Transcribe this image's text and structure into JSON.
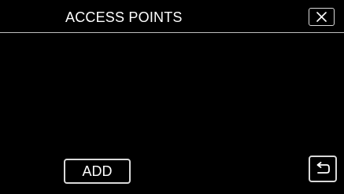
{
  "header": {
    "title": "ACCESS POINTS",
    "close_icon": "close-icon"
  },
  "list": {
    "items": []
  },
  "footer": {
    "add_label": "ADD",
    "back_icon": "return-arrow-icon"
  },
  "colors": {
    "background": "#000000",
    "text": "#ffffff",
    "border": "#d9d9d9",
    "divider": "#bfbfbf"
  }
}
